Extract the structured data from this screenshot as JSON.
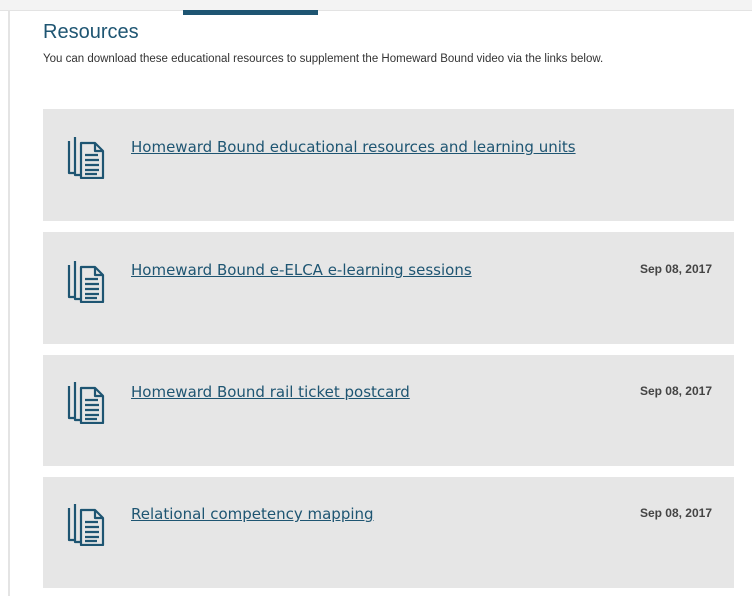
{
  "header": {
    "title": "Resources",
    "intro": "You can download these educational resources to supplement the Homeward Bound video via the links below."
  },
  "resources": [
    {
      "label": "Homeward Bound educational resources and learning units",
      "date": ""
    },
    {
      "label": "Homeward Bound e-ELCA e-learning sessions",
      "date": "Sep 08, 2017"
    },
    {
      "label": "Homeward Bound rail ticket postcard",
      "date": "Sep 08, 2017"
    },
    {
      "label": "Relational competency mapping",
      "date": "Sep 08, 2017"
    }
  ],
  "icons": {
    "resource": "documents-stack-icon"
  },
  "colors": {
    "accent": "#1e5572",
    "card_bg": "#e6e6e6",
    "date": "#444444"
  }
}
